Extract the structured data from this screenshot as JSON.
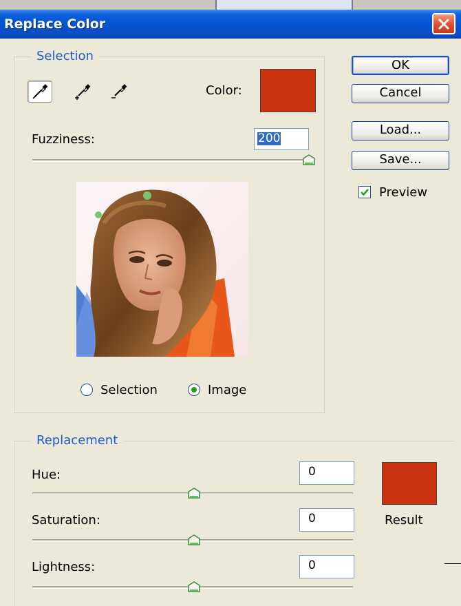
{
  "window": {
    "title": "Replace Color"
  },
  "selection_group": {
    "legend": "Selection",
    "color_label": "Color:",
    "color_swatch": "#cc3311",
    "fuzziness_label": "Fuzziness:",
    "fuzziness_value": "200",
    "fuzziness_slider_fraction": 1.0,
    "tools": [
      "eyedropper-icon",
      "eyedropper-add-icon",
      "eyedropper-subtract-icon"
    ],
    "radio_selection": "Selection",
    "radio_image": "Image",
    "selected_view": "Image"
  },
  "buttons": {
    "ok": "OK",
    "cancel": "Cancel",
    "load": "Load...",
    "save": "Save..."
  },
  "preview": {
    "label": "Preview",
    "checked": true
  },
  "replacement_group": {
    "legend": "Replacement",
    "hue_label": "Hue:",
    "hue_value": "0",
    "saturation_label": "Saturation:",
    "saturation_value": "0",
    "lightness_label": "Lightness:",
    "lightness_value": "0",
    "result_label": "Result",
    "result_swatch": "#cc3311"
  }
}
